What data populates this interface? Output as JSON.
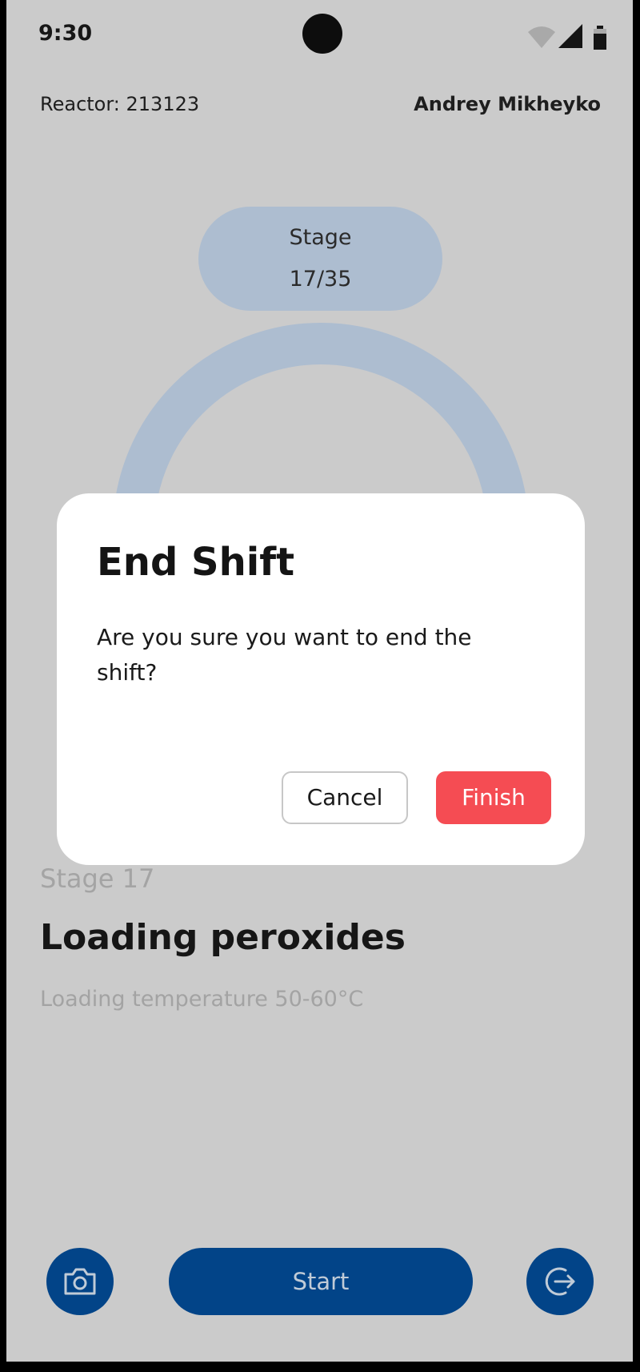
{
  "status_bar": {
    "time": "9:30",
    "icons": [
      "wifi-icon",
      "cell-signal-icon",
      "battery-icon"
    ]
  },
  "header": {
    "reactor": "Reactor: 213123",
    "user": "Andrey Mikheyko"
  },
  "progress": {
    "label": "Stage",
    "value": "17/35",
    "current": 17,
    "total": 35
  },
  "stage": {
    "number": "Stage 17",
    "title": "Loading peroxides",
    "description": "Loading temperature 50-60°C"
  },
  "actions": {
    "camera_icon": "camera-icon",
    "start_label": "Start",
    "exit_icon": "exit-icon"
  },
  "dialog": {
    "title": "End Shift",
    "message": "Are you sure you want to end the shift?",
    "cancel_label": "Cancel",
    "finish_label": "Finish"
  },
  "colors": {
    "primary": "#024488",
    "progress_track": "#adbdd0",
    "danger": "#f54c53",
    "overlay_background": "#cbcbcb"
  }
}
